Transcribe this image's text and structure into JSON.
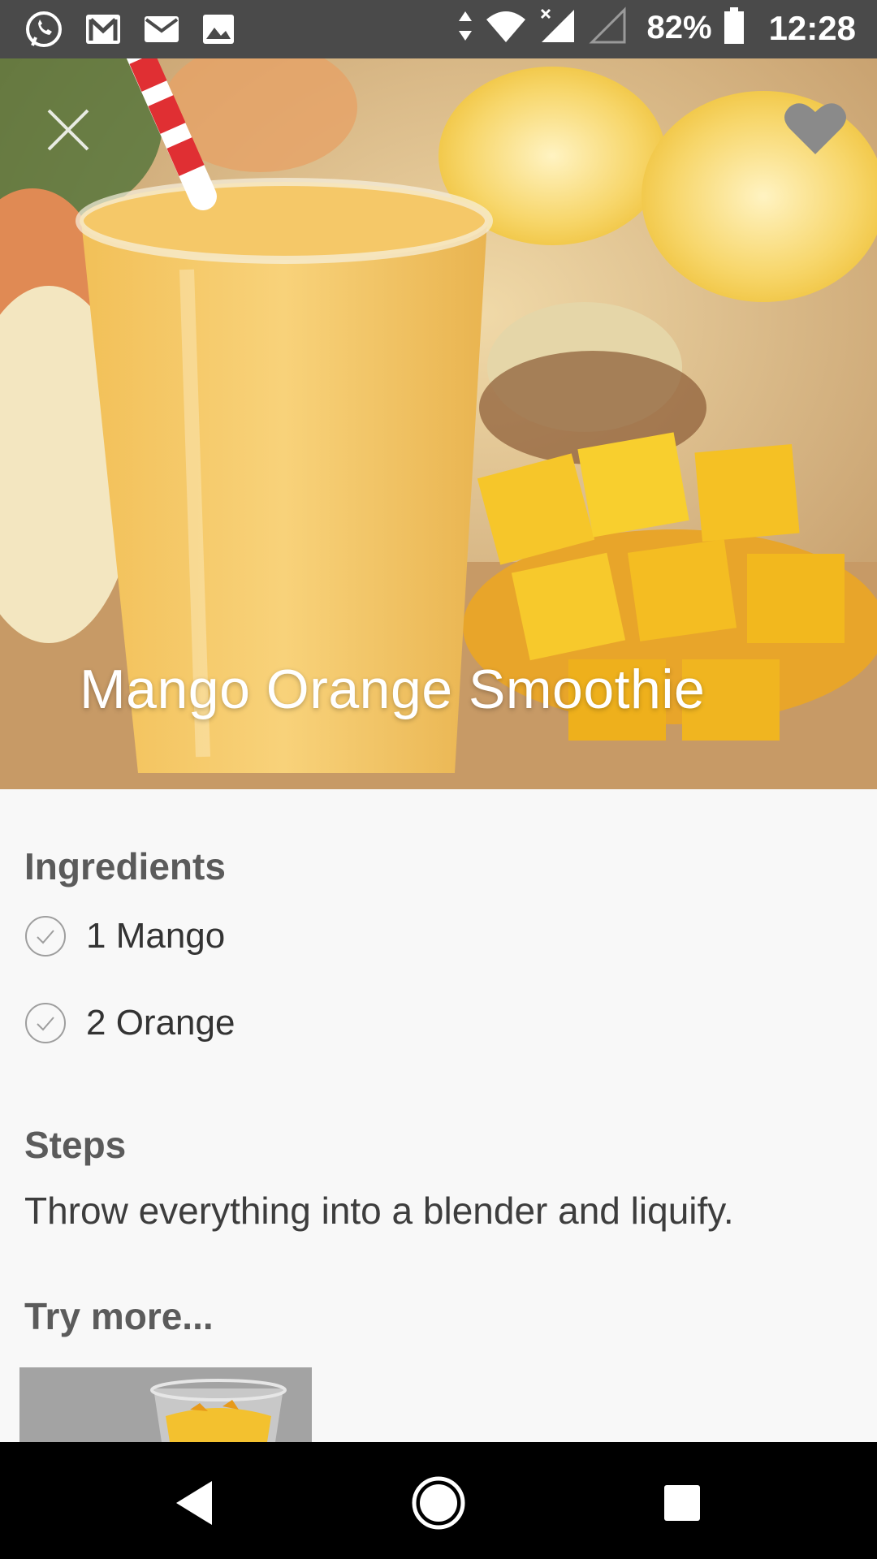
{
  "status_bar": {
    "battery_percent": "82%",
    "time": "12:28",
    "left_icons": [
      "whatsapp-icon",
      "gmail-icon",
      "mail-icon",
      "image-icon"
    ],
    "right_icons": [
      "data-arrows-icon",
      "wifi-icon",
      "signal-icon",
      "signal-empty-icon",
      "battery-icon"
    ]
  },
  "recipe": {
    "title": "Mango Orange Smoothie"
  },
  "ingredients": {
    "heading": "Ingredients",
    "items": [
      {
        "label": "1 Mango",
        "checked": true
      },
      {
        "label": "2 Orange",
        "checked": true
      }
    ]
  },
  "steps": {
    "heading": "Steps",
    "text": "Throw everything into a blender and liquify."
  },
  "more": {
    "heading": "Try more..."
  },
  "nav": {
    "buttons": [
      "back-icon",
      "home-icon",
      "recents-icon"
    ]
  },
  "colors": {
    "status_bar": "#4a4a4a",
    "background": "#f8f8f8",
    "heading_text": "#5b5b5b",
    "nav_bar": "#000000"
  }
}
